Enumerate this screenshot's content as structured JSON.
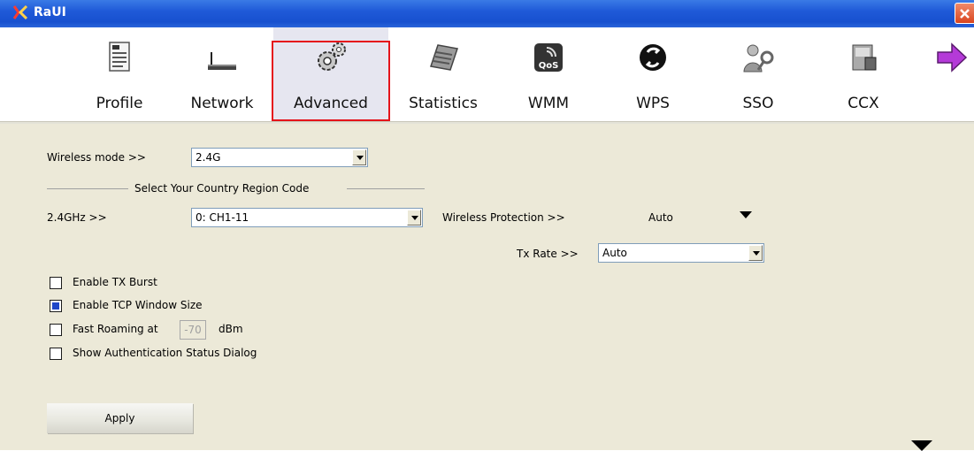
{
  "window": {
    "title": "RaUI"
  },
  "toolbar": {
    "items": [
      {
        "label": "Profile",
        "icon": "profile-icon"
      },
      {
        "label": "Network",
        "icon": "network-icon"
      },
      {
        "label": "Advanced",
        "icon": "gears-icon",
        "selected": true
      },
      {
        "label": "Statistics",
        "icon": "statistics-icon"
      },
      {
        "label": "WMM",
        "icon": "wmm-qos-icon"
      },
      {
        "label": "WPS",
        "icon": "wps-icon"
      },
      {
        "label": "SSO",
        "icon": "sso-key-icon"
      },
      {
        "label": "CCX",
        "icon": "ccx-icon"
      }
    ],
    "next_icon": "arrow-right-icon"
  },
  "advanced": {
    "wireless_mode_label": "Wireless mode >>",
    "wireless_mode_value": "2.4G",
    "country_region_header": "Select Your Country Region Code",
    "band_label": "2.4GHz >>",
    "band_value": "0: CH1-11",
    "protection_label": "Wireless Protection >>",
    "protection_value": "Auto",
    "tx_rate_label": "Tx Rate >>",
    "tx_rate_value": "Auto",
    "checkboxes": [
      {
        "label": "Enable TX Burst",
        "checked": false
      },
      {
        "label": "Enable TCP Window Size",
        "checked": true
      },
      {
        "label": "Fast Roaming at",
        "checked": false
      },
      {
        "label": "Show Authentication Status Dialog",
        "checked": false
      }
    ],
    "roaming_value": "-70",
    "roaming_unit": "dBm",
    "apply_label": "Apply"
  },
  "colors": {
    "titlebar": "#1f5ad8",
    "panel": "#ece9d8",
    "highlight": "#e5141b",
    "check": "#1e46c8"
  }
}
